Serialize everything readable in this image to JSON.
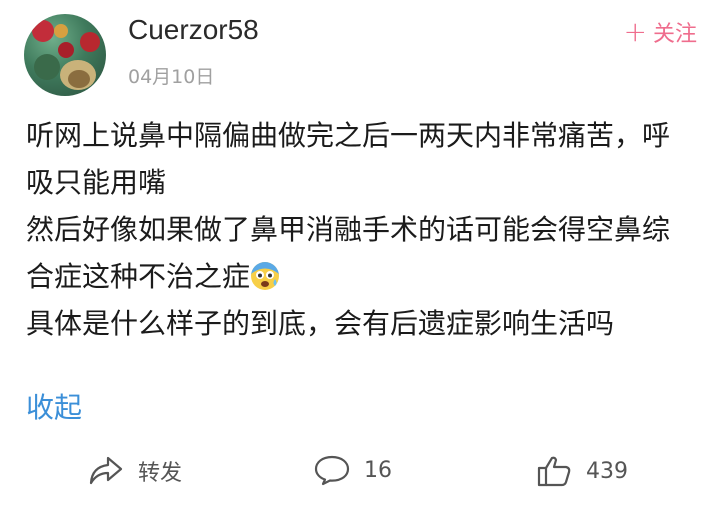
{
  "user": {
    "name": "Cuerzor58",
    "date": "04月10日",
    "follow_label": "关注",
    "follow_icon": "plus-icon"
  },
  "post": {
    "lines": [
      "听网上说鼻中隔偏曲做完之后一两天内非常痛苦，呼吸只能用嘴",
      "然后好像如果做了鼻甲消融手术的话可能会得空鼻综合症这种不治之症",
      "具体是什么样子的到底，会有后遗症影响生活吗"
    ],
    "emoji": "fearful-face-emoji",
    "collapse_label": "收起"
  },
  "actions": {
    "repost_label": "转发",
    "comment_count": "16",
    "like_count": "439"
  },
  "colors": {
    "accent_follow": "#ef6d8d",
    "link_blue": "#3b8fd8",
    "meta_gray": "#a0a0a0"
  }
}
